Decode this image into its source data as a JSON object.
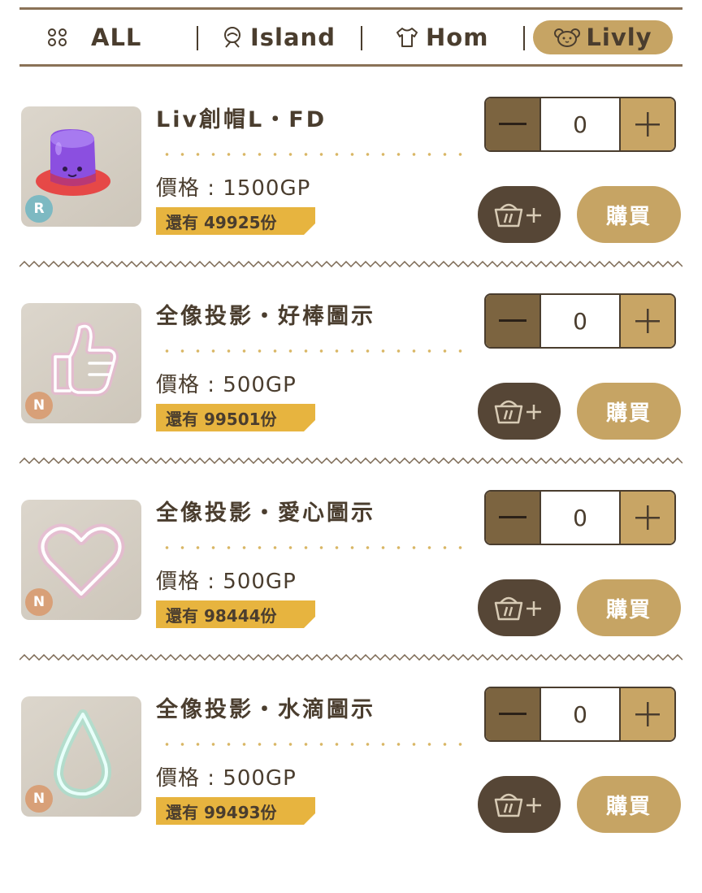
{
  "tabs": [
    {
      "label": "ALL",
      "icon": "grid-dots-icon",
      "active": false
    },
    {
      "label": "Island",
      "icon": "island-icon",
      "active": false
    },
    {
      "label": "Hom",
      "icon": "shirt-icon",
      "active": false
    },
    {
      "label": "Livly",
      "icon": "livly-face-icon",
      "active": true
    }
  ],
  "colors": {
    "accent": "#c6a464",
    "dark_brown": "#564636",
    "stock_tag": "#e7b43f",
    "rarity_r": "#7db9c2",
    "rarity_n": "#d8a078"
  },
  "items": [
    {
      "name": "Liv創帽L・FD",
      "price": "價格 : 1500GP",
      "stock": "還有 49925份",
      "rarity": "R",
      "quantity": "0",
      "buy_label": "購買",
      "image": "purple-jelly-hat-icon"
    },
    {
      "name": "全像投影・好棒圖示",
      "price": "價格 : 500GP",
      "stock": "還有 99501份",
      "rarity": "N",
      "quantity": "0",
      "buy_label": "購買",
      "image": "neon-thumbs-up-icon"
    },
    {
      "name": "全像投影・愛心圖示",
      "price": "價格 : 500GP",
      "stock": "還有 98444份",
      "rarity": "N",
      "quantity": "0",
      "buy_label": "購買",
      "image": "neon-heart-icon"
    },
    {
      "name": "全像投影・水滴圖示",
      "price": "價格 : 500GP",
      "stock": "還有 99493份",
      "rarity": "N",
      "quantity": "0",
      "buy_label": "購買",
      "image": "neon-droplet-icon"
    }
  ]
}
